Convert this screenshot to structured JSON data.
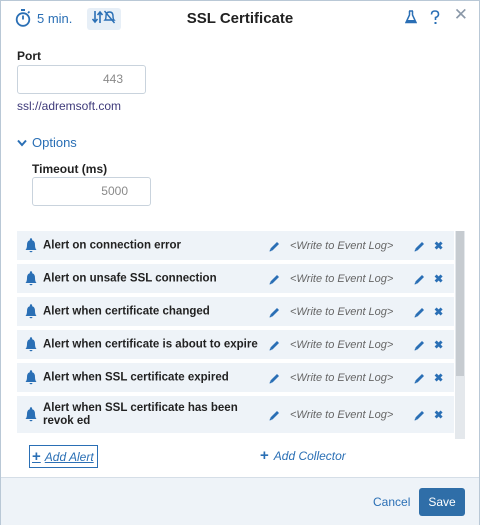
{
  "header": {
    "timer_label": "5 min.",
    "title": "SSL Certificate"
  },
  "port": {
    "label": "Port",
    "value": "443"
  },
  "url": "ssl://adremsoft.com",
  "options": {
    "label": "Options",
    "timeout_label": "Timeout (ms)",
    "timeout_value": "5000"
  },
  "alerts": [
    {
      "name": "Alert on connection error",
      "action": "<Write to Event Log>"
    },
    {
      "name": "Alert on unsafe SSL connection",
      "action": "<Write to Event Log>"
    },
    {
      "name": "Alert when certificate changed",
      "action": "<Write to Event Log>"
    },
    {
      "name": "Alert when certificate is about to expire",
      "action": "<Write to Event Log>"
    },
    {
      "name": "Alert when SSL certificate expired",
      "action": "<Write to Event Log>"
    },
    {
      "name": "Alert when SSL certificate has been revok ed",
      "action": "<Write to Event Log>"
    }
  ],
  "actions": {
    "add_alert": "Add Alert",
    "add_collector": "Add Collector"
  },
  "footer": {
    "cancel": "Cancel",
    "save": "Save"
  },
  "colors": {
    "accent": "#2a6fb5",
    "save_button": "#2f6ea8",
    "row_background": "#eef3f8"
  }
}
